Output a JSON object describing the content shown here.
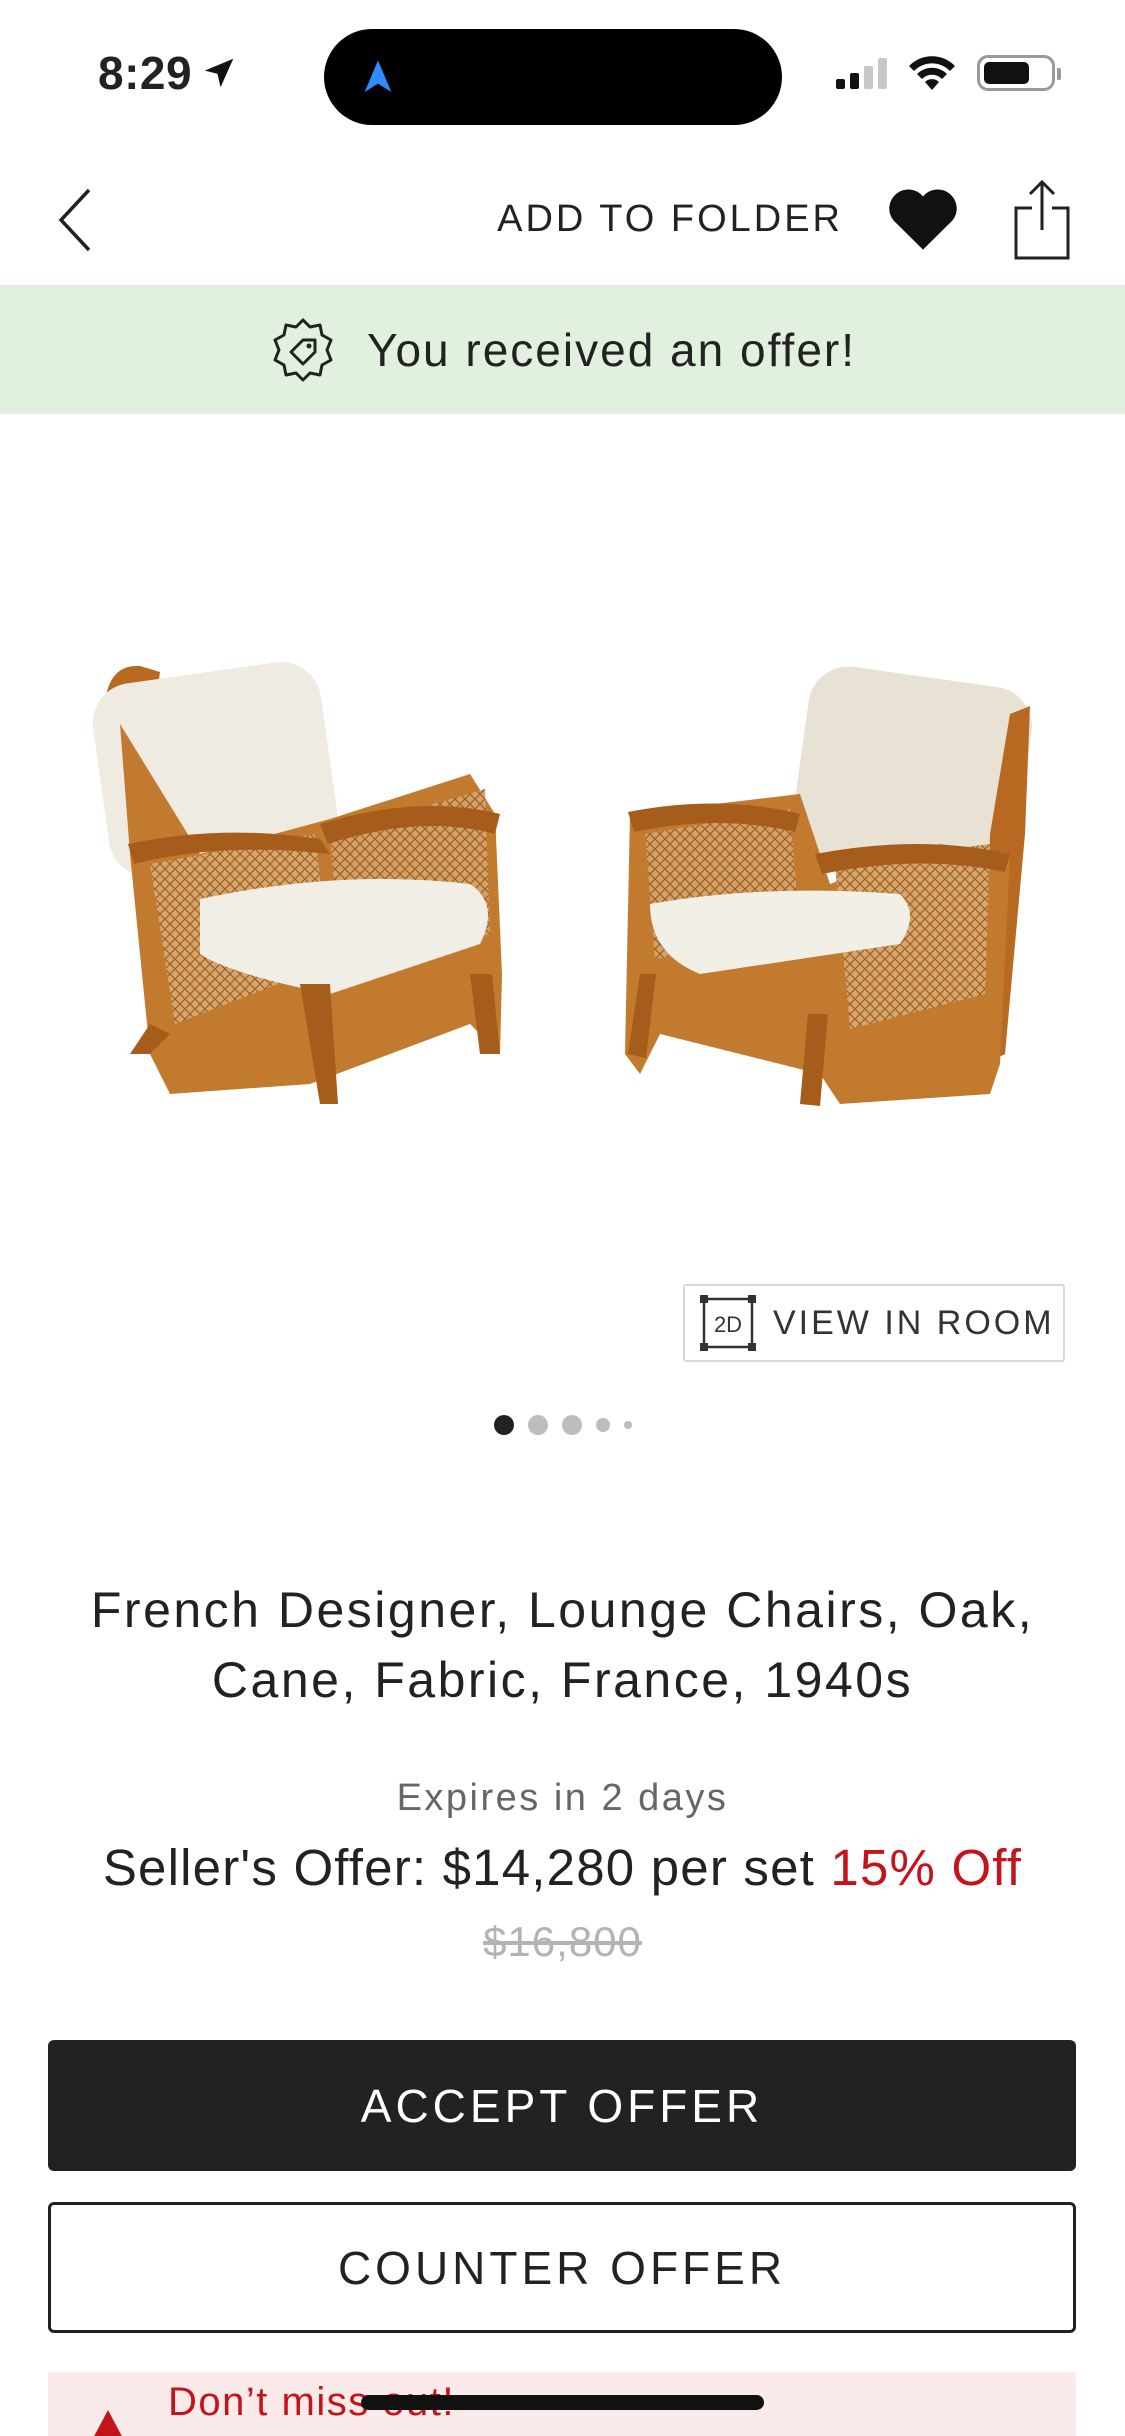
{
  "status_bar": {
    "time": "8:29"
  },
  "nav": {
    "add_to_folder_label": "ADD TO FOLDER"
  },
  "banner": {
    "text": "You received an offer!"
  },
  "gallery": {
    "view_in_room_label": "VIEW IN ROOM",
    "view_in_room_icon_text": "2D",
    "dots_total": 5,
    "active_dot": 1
  },
  "product": {
    "title": "French Designer, Lounge Chairs, Oak, Cane, Fabric, France, 1940s"
  },
  "offer": {
    "expires": "Expires in 2 days",
    "label": "Seller's Offer: $14,280 per set",
    "discount": "15% Off",
    "original_price": "$16,800"
  },
  "actions": {
    "accept_label": "ACCEPT OFFER",
    "counter_label": "COUNTER OFFER"
  },
  "alert": {
    "text": "Don’t miss out!"
  },
  "colors": {
    "banner_bg": "#e2f1df",
    "accent_red": "#c3141b",
    "primary_dark": "#222222"
  }
}
